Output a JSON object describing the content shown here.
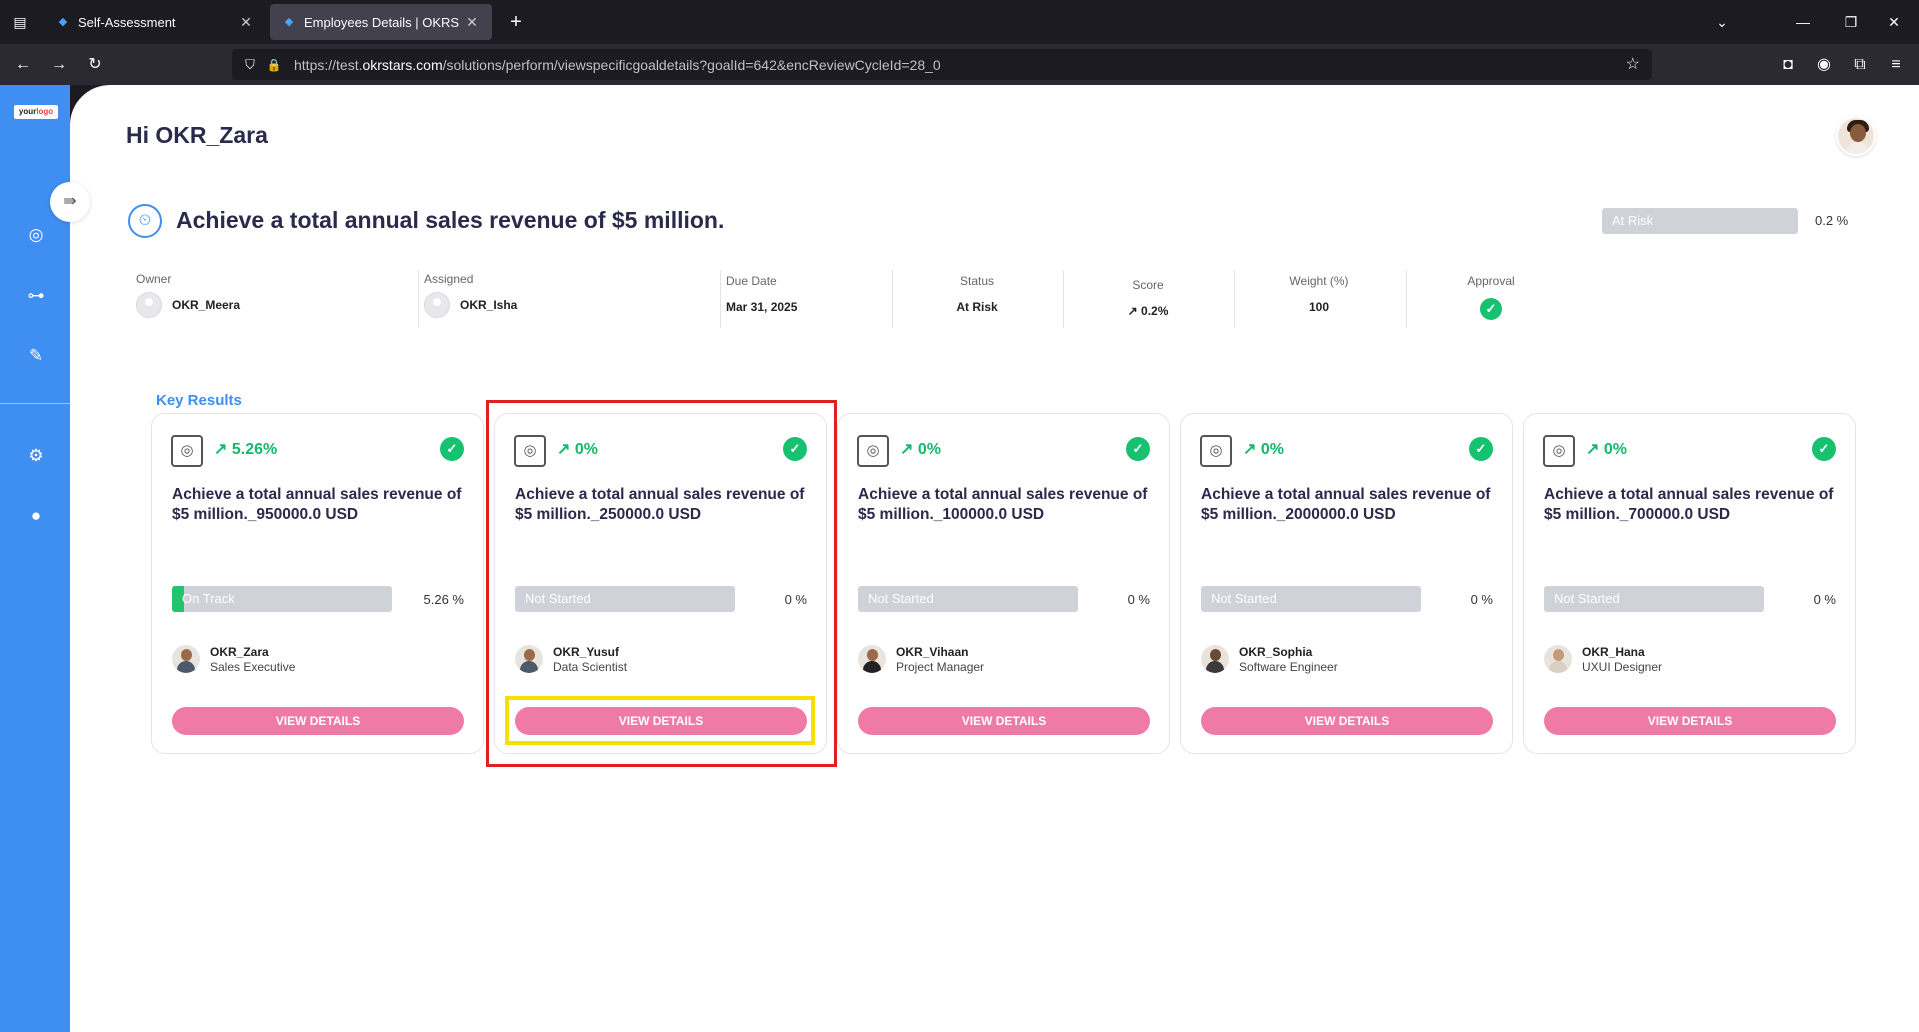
{
  "browser": {
    "tabs": [
      {
        "title": "Self-Assessment",
        "active": false
      },
      {
        "title": "Employees Details | OKRS",
        "active": true
      }
    ],
    "url_prefix": "https://test.",
    "url_domain": "okrstars.com",
    "url_path": "/solutions/perform/viewspecificgoaldetails?goalId=642&encReviewCycleId=28_0"
  },
  "sidebar": {
    "logo_text": "your",
    "logo_sup": "logo",
    "icons": [
      "target-icon",
      "hierarchy-icon",
      "report-edit-icon",
      "settings-icon",
      "user-icon"
    ]
  },
  "header": {
    "greeting": "Hi OKR_Zara"
  },
  "goal": {
    "title": "Achieve a total annual sales revenue of $5 million.",
    "status_bar_label": "At Risk",
    "progress_pct": "0.2 %",
    "owner_label": "Owner",
    "owner": "OKR_Meera",
    "assigned_label": "Assigned",
    "assigned": "OKR_Isha",
    "due_label": "Due Date",
    "due": "Mar 31, 2025",
    "status_label": "Status",
    "status": "At Risk",
    "score_label": "Score",
    "score": "↗ 0.2%",
    "weight_label": "Weight (%)",
    "weight": "100",
    "approval_label": "Approval"
  },
  "key_results_heading": "Key Results",
  "key_results": [
    {
      "score": "↗ 5.26%",
      "title": "Achieve a total annual sales revenue of $5 million._950000.0 USD",
      "status": "On Track",
      "pct": "5.26 %",
      "progress": 0.0526,
      "name": "OKR_Zara",
      "role": "Sales Executive",
      "button": "VIEW DETAILS"
    },
    {
      "score": "↗ 0%",
      "title": "Achieve a total annual sales revenue of $5 million._250000.0 USD",
      "status": "Not Started",
      "pct": "0 %",
      "progress": 0,
      "name": "OKR_Yusuf",
      "role": "Data Scientist",
      "button": "VIEW DETAILS"
    },
    {
      "score": "↗ 0%",
      "title": "Achieve a total annual sales revenue of $5 million._100000.0 USD",
      "status": "Not Started",
      "pct": "0 %",
      "progress": 0,
      "name": "OKR_Vihaan",
      "role": "Project Manager",
      "button": "VIEW DETAILS"
    },
    {
      "score": "↗ 0%",
      "title": "Achieve a total annual sales revenue of $5 million._2000000.0 USD",
      "status": "Not Started",
      "pct": "0 %",
      "progress": 0,
      "name": "OKR_Sophia",
      "role": "Software Engineer",
      "button": "VIEW DETAILS"
    },
    {
      "score": "↗ 0%",
      "title": "Achieve a total annual sales revenue of $5 million._700000.0 USD",
      "status": "Not Started",
      "pct": "0 %",
      "progress": 0,
      "name": "OKR_Hana",
      "role": "UXUI Designer",
      "button": "VIEW DETAILS"
    }
  ],
  "colors": {
    "sidebar": "#3f8ef2",
    "accent_pink": "#f07aa6",
    "success_green": "#16c26f",
    "bar_gray": "#cfd2d8"
  }
}
